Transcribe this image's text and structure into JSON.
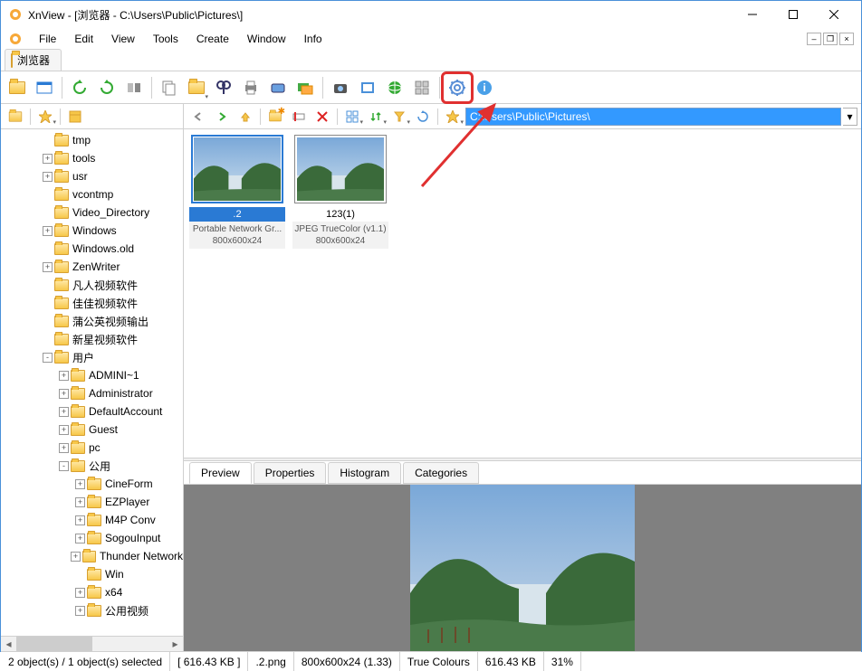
{
  "window": {
    "title": "XnView - [浏览器 - C:\\Users\\Public\\Pictures\\]"
  },
  "menu": {
    "items": [
      "File",
      "Edit",
      "View",
      "Tools",
      "Create",
      "Window",
      "Info"
    ]
  },
  "tab": {
    "label": "浏览器"
  },
  "path_input": {
    "value": "C:\\Users\\Public\\Pictures\\"
  },
  "tree": [
    {
      "depth": 2,
      "exp": "",
      "label": "tmp"
    },
    {
      "depth": 2,
      "exp": "+",
      "label": "tools"
    },
    {
      "depth": 2,
      "exp": "+",
      "label": "usr"
    },
    {
      "depth": 2,
      "exp": "",
      "label": "vcontmp"
    },
    {
      "depth": 2,
      "exp": "",
      "label": "Video_Directory"
    },
    {
      "depth": 2,
      "exp": "+",
      "label": "Windows"
    },
    {
      "depth": 2,
      "exp": "",
      "label": "Windows.old"
    },
    {
      "depth": 2,
      "exp": "+",
      "label": "ZenWriter"
    },
    {
      "depth": 2,
      "exp": "",
      "label": "凡人视频软件"
    },
    {
      "depth": 2,
      "exp": "",
      "label": "佳佳视频软件"
    },
    {
      "depth": 2,
      "exp": "",
      "label": "蒲公英视频输出"
    },
    {
      "depth": 2,
      "exp": "",
      "label": "新星视频软件"
    },
    {
      "depth": 2,
      "exp": "-",
      "label": "用户"
    },
    {
      "depth": 3,
      "exp": "+",
      "label": "ADMINI~1"
    },
    {
      "depth": 3,
      "exp": "+",
      "label": "Administrator"
    },
    {
      "depth": 3,
      "exp": "+",
      "label": "DefaultAccount"
    },
    {
      "depth": 3,
      "exp": "+",
      "label": "Guest"
    },
    {
      "depth": 3,
      "exp": "+",
      "label": "pc"
    },
    {
      "depth": 3,
      "exp": "-",
      "label": "公用"
    },
    {
      "depth": 4,
      "exp": "+",
      "label": "CineForm"
    },
    {
      "depth": 4,
      "exp": "+",
      "label": "EZPlayer"
    },
    {
      "depth": 4,
      "exp": "+",
      "label": "M4P Conv"
    },
    {
      "depth": 4,
      "exp": "+",
      "label": "SogouInput"
    },
    {
      "depth": 4,
      "exp": "+",
      "label": "Thunder Network"
    },
    {
      "depth": 4,
      "exp": "",
      "label": "Win"
    },
    {
      "depth": 4,
      "exp": "+",
      "label": "x64"
    },
    {
      "depth": 4,
      "exp": "+",
      "label": "公用视频"
    }
  ],
  "thumbs": [
    {
      "name": ".2",
      "meta1": "Portable Network Gr...",
      "meta2": "800x600x24",
      "sel": true
    },
    {
      "name": "123(1)",
      "meta1": "JPEG TrueColor (v1.1)",
      "meta2": "800x600x24",
      "sel": false
    }
  ],
  "detail_tabs": [
    "Preview",
    "Properties",
    "Histogram",
    "Categories"
  ],
  "status": {
    "objects": "2 object(s) / 1 object(s) selected",
    "size1": "[ 616.43 KB ]",
    "fname": ".2.png",
    "dims": "800x600x24 (1.33)",
    "mode": "True Colours",
    "size2": "616.43 KB",
    "zoom": "31%"
  }
}
